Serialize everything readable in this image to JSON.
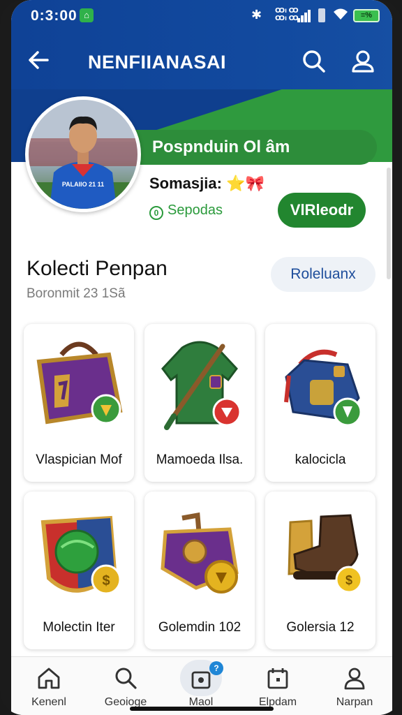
{
  "status_bar": {
    "time": "0:3:00",
    "app_badge": "⌂",
    "network_line1": "Ꝏı Ꝏ",
    "network_line2": "Ꝏı Ꝏ",
    "battery": "≡%"
  },
  "header": {
    "title": "NENFIIANASAI"
  },
  "player": {
    "name": "Pospnduin Ol âm",
    "status_label": "Somasjia:",
    "status_icons": "⭐🎀",
    "sub_icon": "0",
    "sub_label": "Sepodas",
    "action_label": "VlRleodr",
    "jersey_text": "PALAIIO 21 11"
  },
  "collection": {
    "title": "Kolecti Penpan",
    "subtitle": "Boronmit 23 1Sã",
    "action_label": "Roleluanx",
    "items": [
      {
        "label": "Vlaspician Mof",
        "icon": "treasure-chest-icon",
        "badge_color": "#3a9b3c"
      },
      {
        "label": "Mamoeda Ilsa.",
        "icon": "green-hoodie-icon",
        "badge_color": "#d9332f"
      },
      {
        "label": "kalocicla",
        "icon": "blue-backpack-icon",
        "badge_color": "#3a9b3c"
      },
      {
        "label": "Molectin Iter",
        "icon": "shield-ball-icon",
        "badge_color": "#e4b320"
      },
      {
        "label": "Golemdin 102",
        "icon": "purple-armor-icon",
        "badge_color": "#e4b320"
      },
      {
        "label": "Golersia 12",
        "icon": "leather-boot-icon",
        "badge_color": "#f0c221"
      }
    ]
  },
  "nav": {
    "items": [
      {
        "label": "Kenenl",
        "icon": "home-icon"
      },
      {
        "label": "Geoioge",
        "icon": "search-icon"
      },
      {
        "label": "Maol",
        "icon": "collection-icon",
        "badge": "?"
      },
      {
        "label": "Elpdam",
        "icon": "calendar-icon"
      },
      {
        "label": "Narpan",
        "icon": "person-icon"
      }
    ]
  },
  "colors": {
    "header_blue": "#124a9f",
    "accent_green": "#2d8d3a",
    "button_green": "#22862f"
  }
}
